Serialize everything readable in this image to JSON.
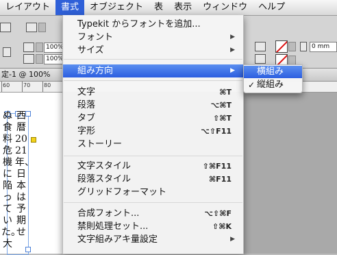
{
  "menubar": {
    "items": [
      {
        "label": "レイアウト"
      },
      {
        "label": "書式",
        "active": true
      },
      {
        "label": "オブジェクト"
      },
      {
        "label": "表"
      },
      {
        "label": "表示"
      },
      {
        "label": "ウィンドウ"
      },
      {
        "label": "ヘルプ"
      }
    ]
  },
  "toolbar": {
    "field_1": "100%",
    "field_2": "100%",
    "field_3": "0 mm"
  },
  "document": {
    "tab_title": "定-1 @ 100%",
    "ruler_labels": [
      "60",
      "70",
      "80"
    ],
    "vertical_text_columns": [
      "西暦2021年、日本は予期せ",
      "ぬ食料危機に陥っていた。大"
    ]
  },
  "menu": {
    "items": [
      {
        "label": "Typekit からフォントを追加..."
      },
      {
        "label": "フォント",
        "submenu": true
      },
      {
        "label": "サイズ",
        "submenu": true
      },
      {
        "label": "組み方向",
        "submenu": true,
        "highlighted": true
      },
      {
        "label": "文字",
        "shortcut": "⌘T"
      },
      {
        "label": "段落",
        "shortcut": "⌥⌘T"
      },
      {
        "label": "タブ",
        "shortcut": "⇧⌘T"
      },
      {
        "label": "字形",
        "shortcut": "⌥⇧F11"
      },
      {
        "label": "ストーリー"
      },
      {
        "label": "文字スタイル",
        "shortcut": "⇧⌘F11"
      },
      {
        "label": "段落スタイル",
        "shortcut": "⌘F11"
      },
      {
        "label": "グリッドフォーマット"
      },
      {
        "label": "合成フォント...",
        "shortcut": "⌥⇧⌘F"
      },
      {
        "label": "禁則処理セット...",
        "shortcut": "⇧⌘K"
      },
      {
        "label": "文字組みアキ量設定",
        "submenu": true
      }
    ]
  },
  "submenu": {
    "items": [
      {
        "label": "横組み",
        "highlighted": true
      },
      {
        "label": "縦組み",
        "checked": true,
        "check_glyph": "✓"
      }
    ]
  },
  "colors": {
    "highlight": "#2c5ee0",
    "menubar_active": "#2f60d8",
    "frame_border": "#7aa6e6"
  },
  "icons": {
    "submenu_arrow": "▶"
  }
}
